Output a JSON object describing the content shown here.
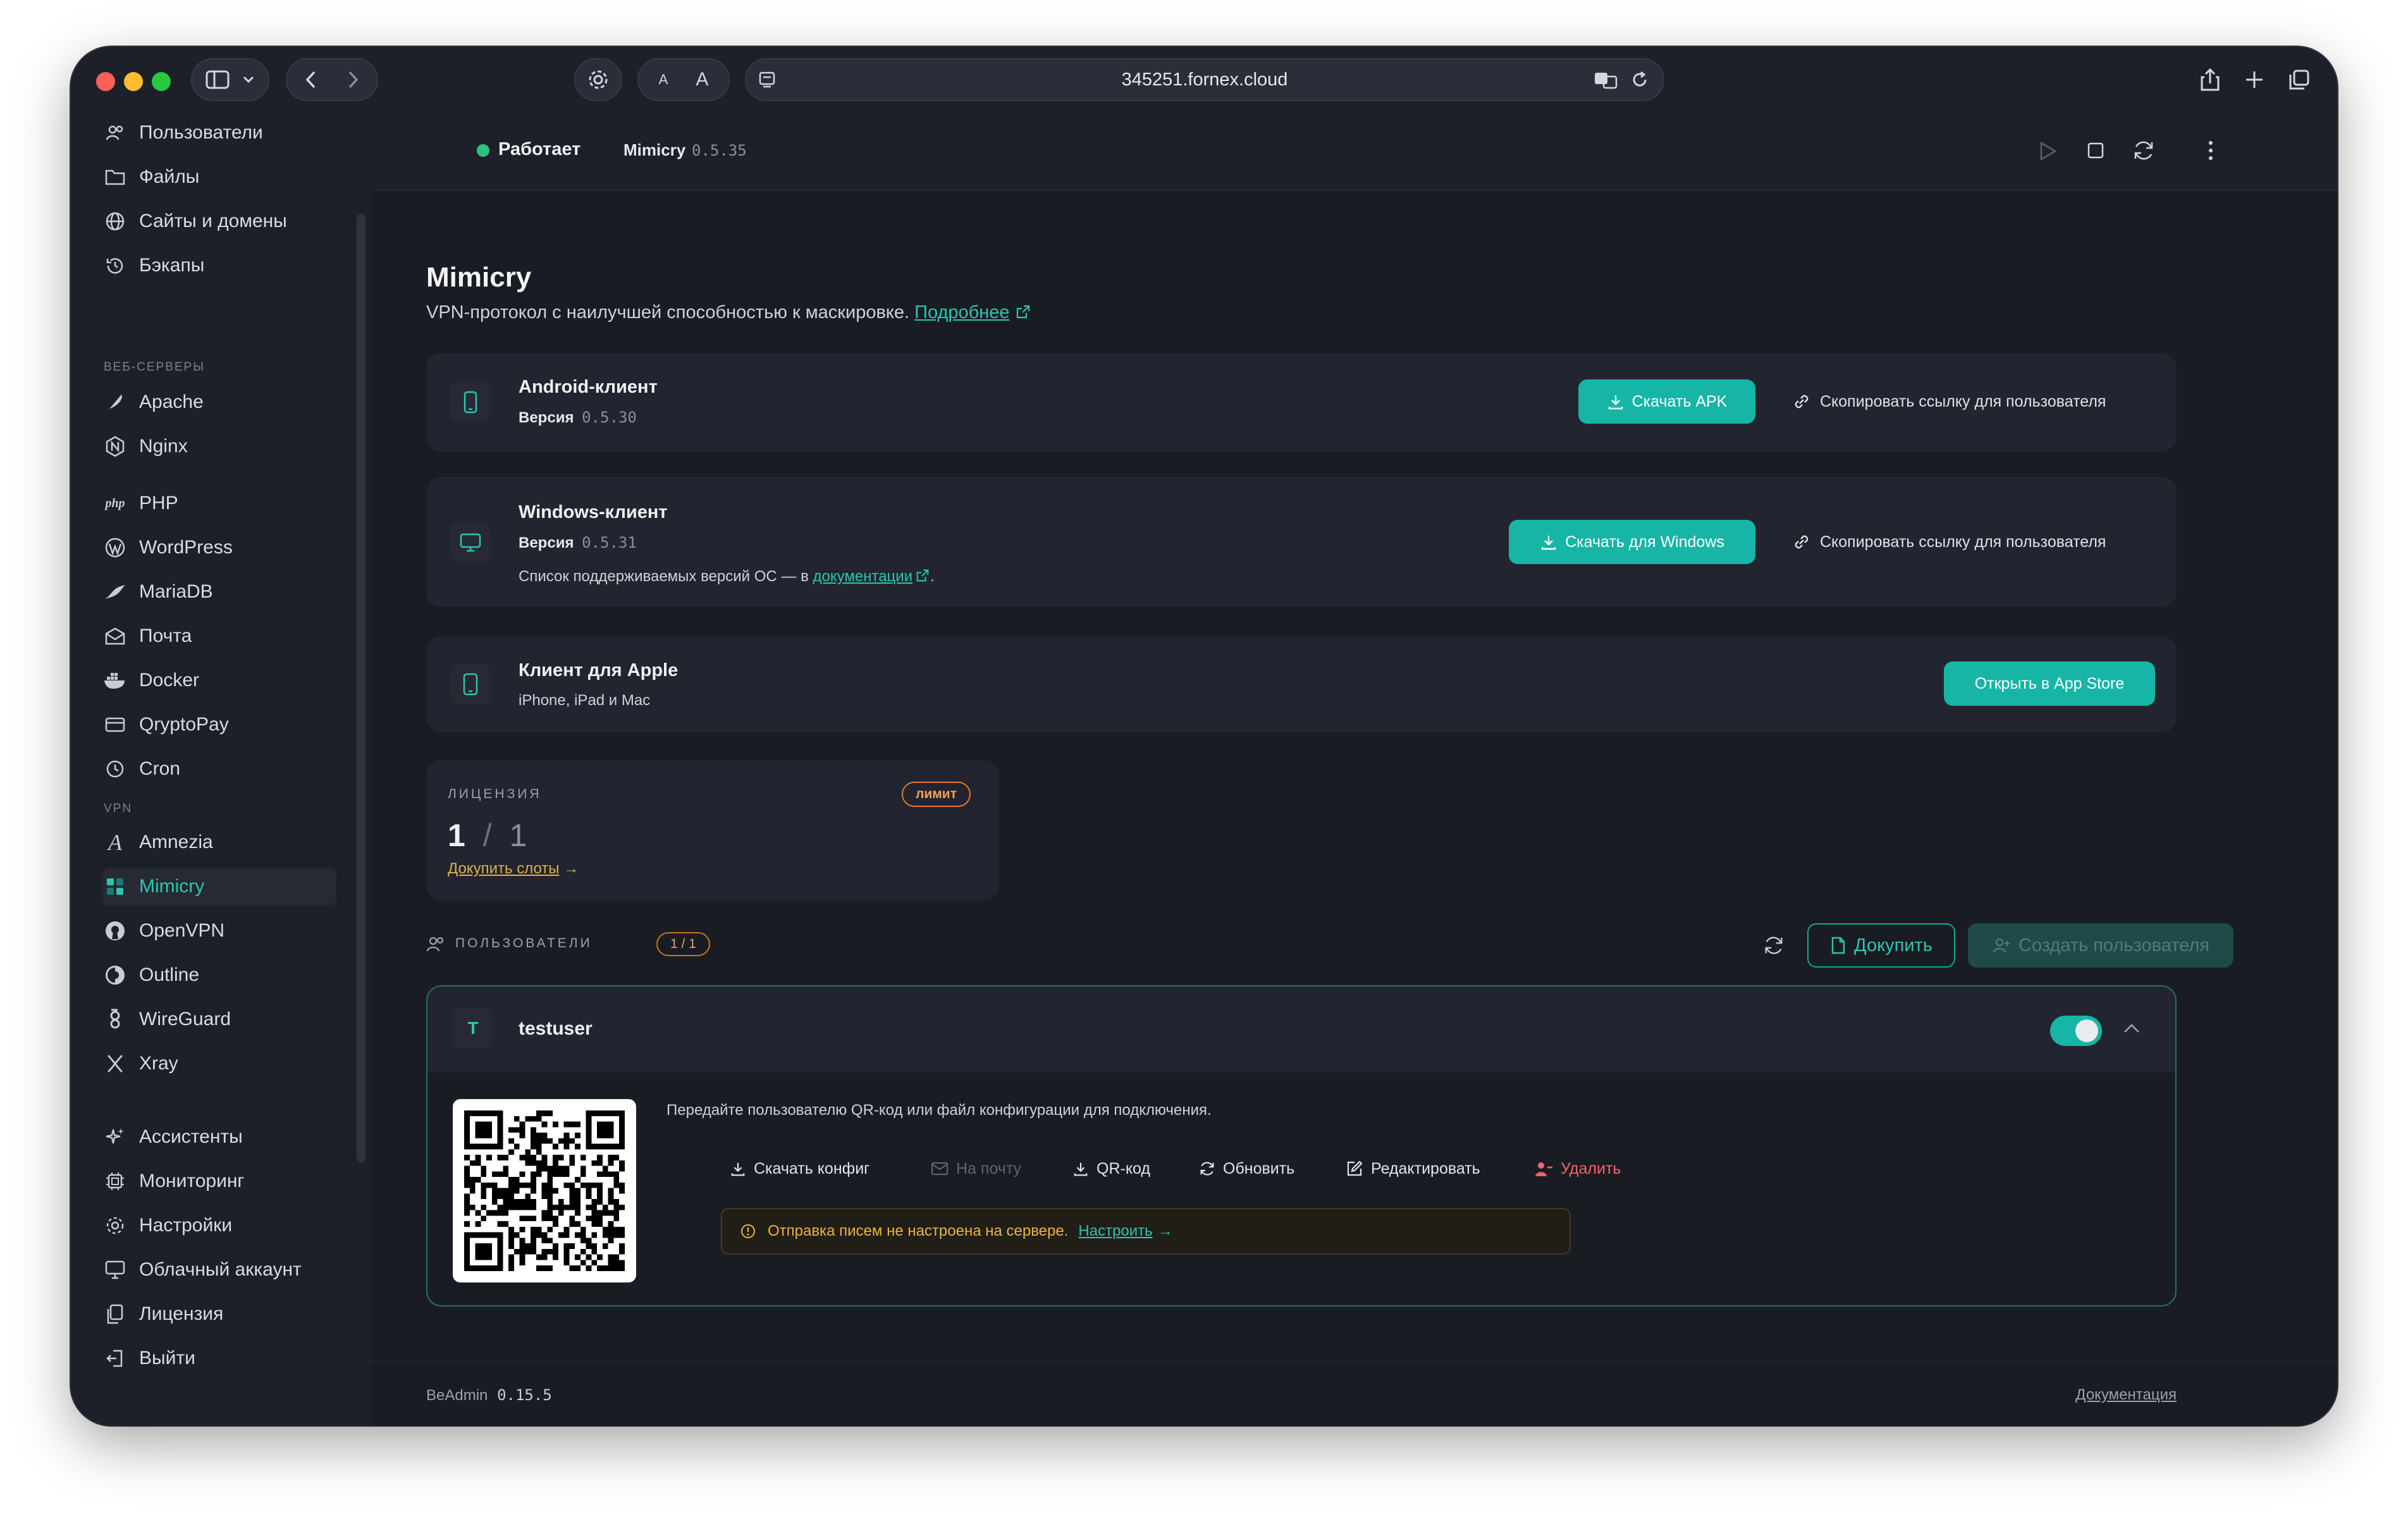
{
  "browser": {
    "url": "345251.fornex.cloud",
    "text_small": "A",
    "text_large": "A"
  },
  "sidebar": {
    "items_top": [
      "Пользователи",
      "Файлы",
      "Сайты и домены",
      "Бэкапы"
    ],
    "section_web": "ВЕБ-СЕРВЕРЫ",
    "items_web": [
      "Apache",
      "Nginx"
    ],
    "php_logo": "php",
    "items_apps": [
      "PHP",
      "WordPress",
      "MariaDB",
      "Почта",
      "Docker",
      "QryptoPay",
      "Cron"
    ],
    "section_vpn": "VPN",
    "items_vpn": [
      "Amnezia",
      "Mimicry",
      "OpenVPN",
      "Outline",
      "WireGuard",
      "Xray"
    ],
    "items_bottom": [
      "Ассистенты",
      "Мониторинг",
      "Настройки",
      "Облачный аккаунт",
      "Лицензия",
      "Выйти"
    ]
  },
  "service": {
    "status": "Работает",
    "name": "Mimicry",
    "version": "0.5.35",
    "status_color": "#2ec27e"
  },
  "page": {
    "title": "Mimicry",
    "description": "VPN-протокол с наилучшей способностью к маскировке.",
    "more_link": "Подробнее"
  },
  "android": {
    "title": "Android-клиент",
    "version_label": "Версия",
    "version": "0.5.30",
    "download": "Скачать APK",
    "copy_link": "Скопировать ссылку для пользователя"
  },
  "windows": {
    "title": "Windows-клиент",
    "version_label": "Версия",
    "version": "0.5.31",
    "supported_prefix": "Список поддерживаемых версий ОС — в",
    "supported_link": "документации",
    "supported_suffix": ".",
    "download": "Скачать для Windows",
    "copy_link": "Скопировать ссылку для пользователя"
  },
  "apple": {
    "title": "Клиент для Apple",
    "subtitle": "iPhone, iPad и Mac",
    "open_store": "Открыть в App Store"
  },
  "license": {
    "label": "ЛИЦЕНЗИЯ",
    "badge": "лимит",
    "used": "1",
    "separator": "/",
    "total": "1",
    "buy_link": "Докупить слоты"
  },
  "users": {
    "label": "ПОЛЬЗОВАТЕЛИ",
    "count_badge": "1 / 1",
    "buy_button": "Докупить",
    "create_button": "Создать пользователя",
    "list": [
      {
        "initial": "T",
        "name": "testuser",
        "enabled": true,
        "instructions": "Передайте пользователю QR-код или файл конфигурации для подключения.",
        "actions": [
          "Скачать конфиг",
          "На почту",
          "QR-код",
          "Обновить",
          "Редактировать",
          "Удалить"
        ],
        "warning": "Отправка писем не настроена на сервере.",
        "warning_link": "Настроить"
      }
    ]
  },
  "footer": {
    "brand": "BeAdmin",
    "version": "0.15.5",
    "docs": "Документация"
  },
  "colors": {
    "accent": "#17b5a6",
    "accent_text": "#2ec4b0",
    "danger": "#f0646a",
    "warning": "#e0a020"
  }
}
